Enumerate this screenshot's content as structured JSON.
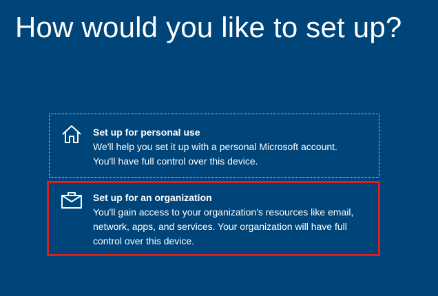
{
  "title": "How would you like to set up?",
  "options": [
    {
      "icon": "home-icon",
      "heading": "Set up for personal use",
      "description": "We'll help you set it up with a personal Microsoft account.\nYou'll have full control over this device."
    },
    {
      "icon": "briefcase-icon",
      "heading": "Set up for an organization",
      "description": "You'll gain access to your organization's resources like email,\nnetwork, apps, and services. Your organization will have full\ncontrol over this device.",
      "highlighted": true,
      "highlight_color": "#e01e1e"
    }
  ],
  "colors": {
    "background": "#00457a",
    "text": "#ffffff"
  }
}
